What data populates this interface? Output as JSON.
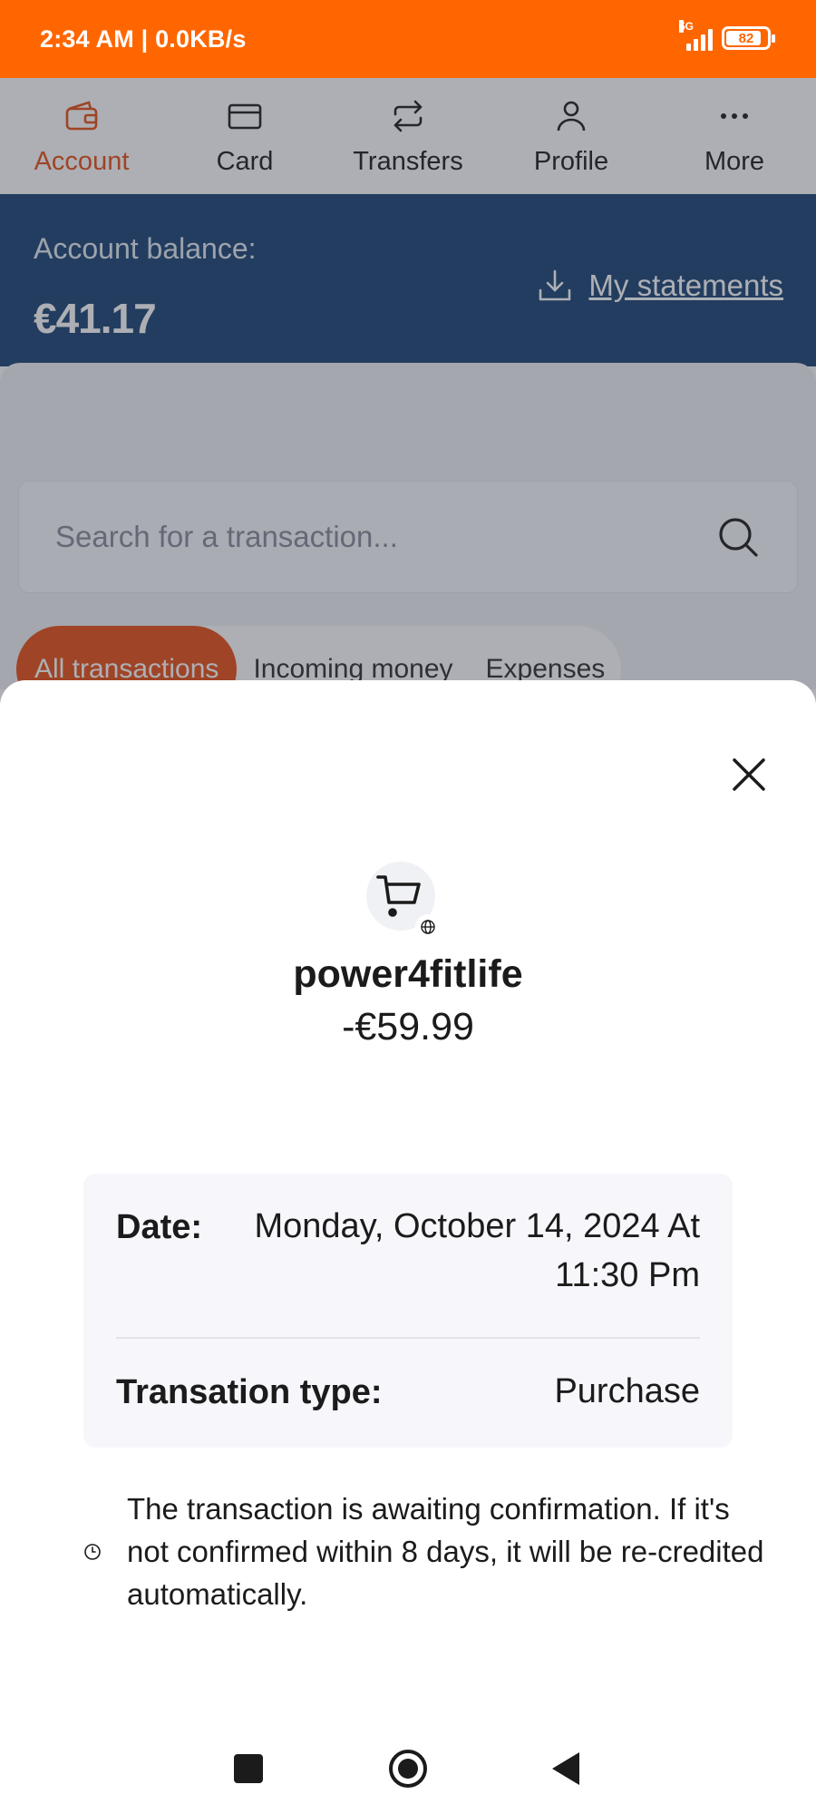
{
  "status_bar": {
    "time": "2:34 AM | 0.0KB/s",
    "network": "5G",
    "battery": "82"
  },
  "tabs": [
    {
      "label": "Account",
      "icon": "wallet-icon",
      "active": true
    },
    {
      "label": "Card",
      "icon": "card-icon",
      "active": false
    },
    {
      "label": "Transfers",
      "icon": "transfer-icon",
      "active": false
    },
    {
      "label": "Profile",
      "icon": "person-icon",
      "active": false
    },
    {
      "label": "More",
      "icon": "more-icon",
      "active": false
    }
  ],
  "header": {
    "balance_label": "Account balance:",
    "balance_value": "€41.17",
    "statements_label": "My statements"
  },
  "search": {
    "placeholder": "Search for a transaction..."
  },
  "filters": [
    {
      "label": "All transactions",
      "active": true
    },
    {
      "label": "Incoming money",
      "active": false
    },
    {
      "label": "Expenses",
      "active": false
    }
  ],
  "sheet": {
    "merchant_name": "power4fitlife",
    "amount": "-€59.99",
    "details": {
      "date_label": "Date:",
      "date_value": "Monday, October 14, 2024 At 11:30 Pm",
      "type_label": "Transation type:",
      "type_value": "Purchase"
    },
    "notice": "The transaction is awaiting confirmation. If it's not confirmed within 8 days, it will be re-credited automatically."
  },
  "colors": {
    "brand_orange": "#ff6600",
    "accent": "#e8531a",
    "header_blue": "#1f4776"
  }
}
